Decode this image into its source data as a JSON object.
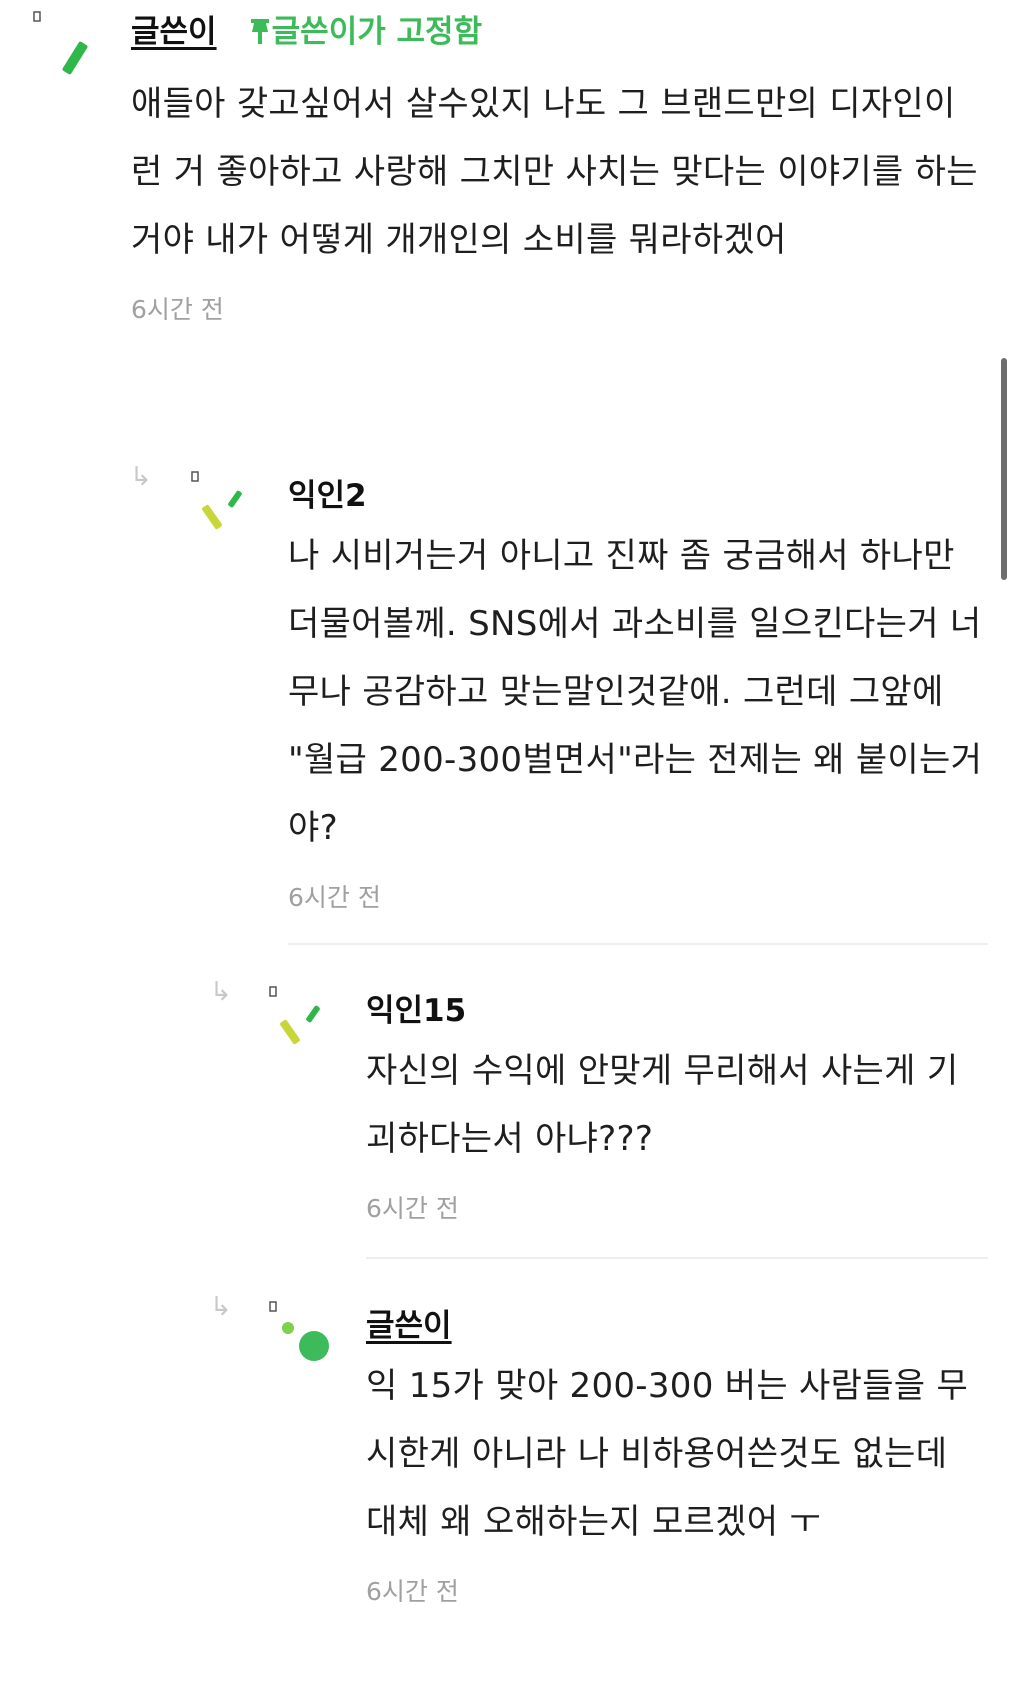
{
  "comments": [
    {
      "author": "글쓴이",
      "pin_label": "글쓴이가 고정함",
      "text": "애들아 갖고싶어서 살수있지 나도 그 브랜드만의 디자인이런 거 좋아하고 사랑해 그치만 사치는 맞다는 이야기를 하는거야 내가 어떻게 개개인의 소비를 뭐라하겠어",
      "time": "6시간 전"
    },
    {
      "author": "익인2",
      "text": "나 시비거는거 아니고 진짜 좀 궁금해서 하나만 더물어볼께. SNS에서 과소비를 일으킨다는거 너무나 공감하고 맞는말인것같애. 그런데 그앞에 \"월급 200-300벌면서\"라는 전제는 왜 붙이는거야?",
      "time": "6시간 전"
    },
    {
      "author": "익인15",
      "text": "자신의 수익에 안맞게 무리해서 사는게 기괴하다는서 아냐???",
      "time": "6시간 전"
    },
    {
      "author": "글쓴이",
      "text": "익 15가 맞아 200-300 버는 사람들을 무시한게 아니라 나 비하용어쓴것도 없는데 대체 왜 오해하는지 모르겠어 ㅜ",
      "time": "6시간 전"
    }
  ],
  "colors": {
    "accent_green": "#3dbb5a",
    "time_gray": "#a0a0a0",
    "avatar_lime": "#c8d63a"
  }
}
